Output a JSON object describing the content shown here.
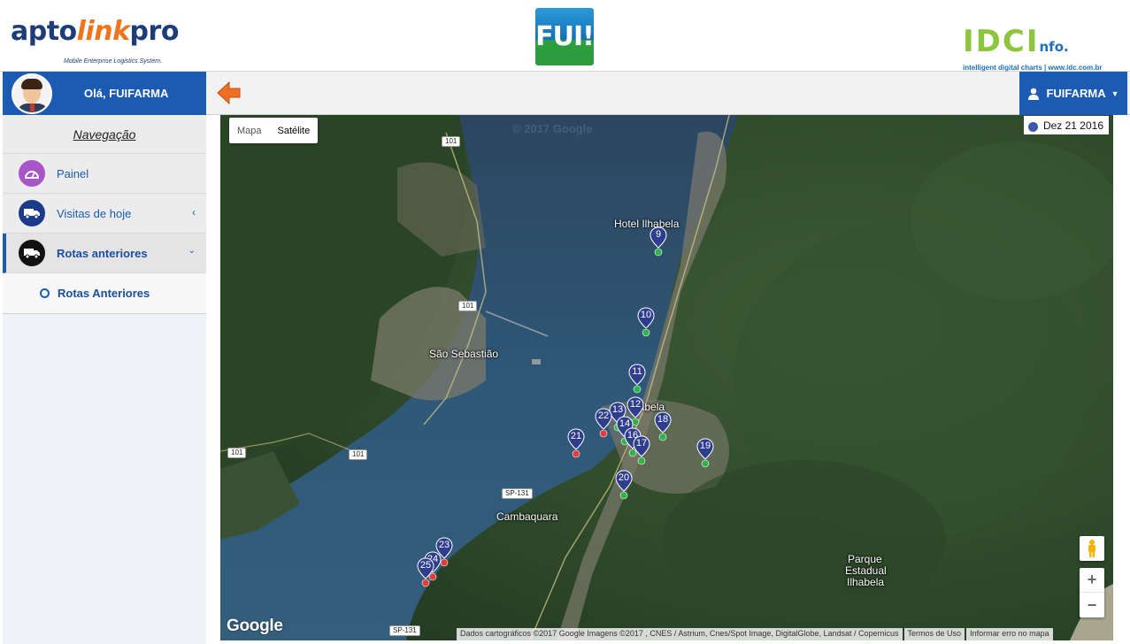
{
  "header": {
    "brand": {
      "pre": "apto",
      "mid": "link",
      "post": "pro",
      "tagline": "Mobile Enterprise Logistics System."
    },
    "fui_logo": "FUI!",
    "idc": {
      "main": "IDCI",
      "suffix": "nfo.",
      "tagline": "intelligent digital charts | www.idc.com.br"
    }
  },
  "user": {
    "greeting": "Olá, FUIFARMA",
    "menu_label": "FUIFARMA"
  },
  "sidebar": {
    "nav_title": "Navegação",
    "items": [
      {
        "label": "Painel",
        "icon": "dashboard-icon",
        "color": "#a855c8"
      },
      {
        "label": "Visitas de hoje",
        "icon": "truck-icon",
        "color": "#1b3a8a"
      },
      {
        "label": "Rotas anteriores",
        "icon": "truck-icon",
        "color": "#111111"
      }
    ],
    "sub_items": [
      {
        "label": "Rotas Anteriores"
      }
    ]
  },
  "map": {
    "type_buttons": [
      "Mapa",
      "Satélite"
    ],
    "legend_date": "Dez 21 2016",
    "labels": {
      "hotel": "Hotel Ilhabela",
      "sao_sebastiao": "São Sebastião",
      "ilhabela": "Ilhabela",
      "cambaquara": "Cambaquara",
      "parque_1": "Parque",
      "parque_2": "Estadual",
      "parque_3": "Ilhabela"
    },
    "roads": [
      "101",
      "101",
      "101",
      "101",
      "SP-131",
      "SP-131"
    ],
    "watermark": "© 2017 Google",
    "google": "Google",
    "attribution": [
      "Dados cartográficos ©2017 Google Imagens ©2017 , CNES / Astrium, Cnes/Spot Image, DigitalGlobe, Landsat / Copernicus",
      "Termos de Uso",
      "Informar erro no mapa"
    ],
    "markers": [
      {
        "n": "9",
        "status": "green"
      },
      {
        "n": "10",
        "status": "green"
      },
      {
        "n": "11",
        "status": "green"
      },
      {
        "n": "12",
        "status": "green"
      },
      {
        "n": "13",
        "status": "green"
      },
      {
        "n": "14",
        "status": "green"
      },
      {
        "n": "16",
        "status": "green"
      },
      {
        "n": "17",
        "status": "green"
      },
      {
        "n": "18",
        "status": "green"
      },
      {
        "n": "19",
        "status": "green"
      },
      {
        "n": "20",
        "status": "green"
      },
      {
        "n": "21",
        "status": "red"
      },
      {
        "n": "22",
        "status": "red"
      },
      {
        "n": "23",
        "status": "red"
      },
      {
        "n": "24",
        "status": "red"
      },
      {
        "n": "25",
        "status": "red"
      }
    ],
    "colors": {
      "green": "#2fb34a",
      "red": "#e23b3b",
      "pin": "#2f3d8f"
    }
  }
}
